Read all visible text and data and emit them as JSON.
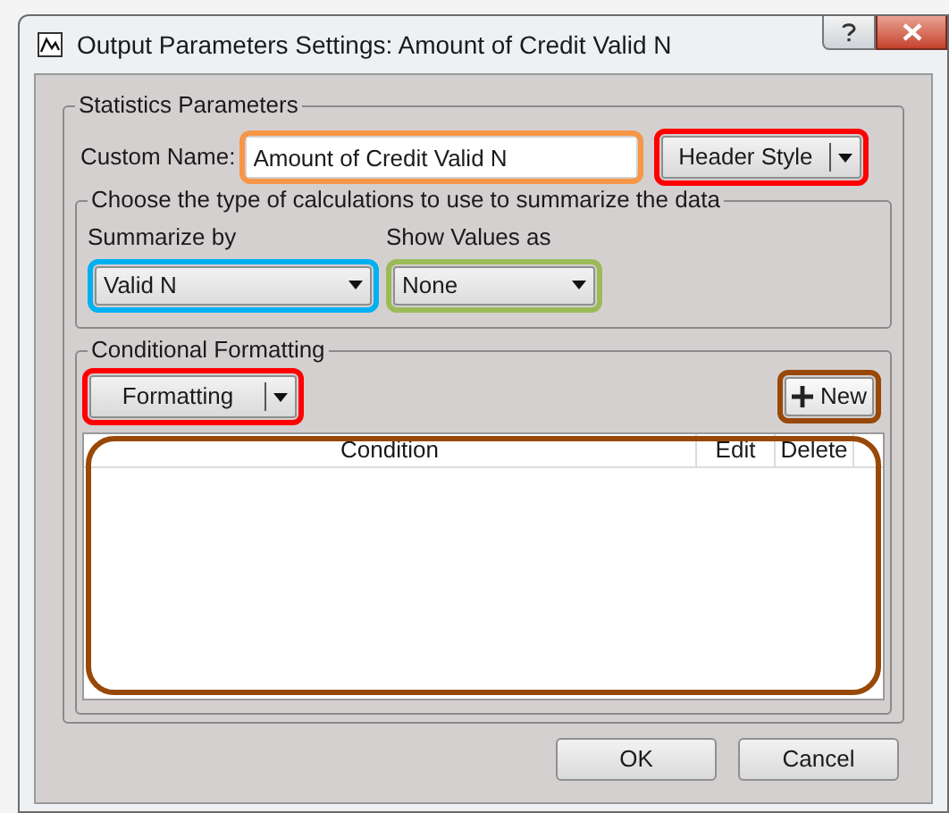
{
  "window": {
    "title": "Output Parameters Settings: Amount of Credit Valid N"
  },
  "statistics_group": {
    "title": "Statistics Parameters",
    "custom_name": {
      "label": "Custom Name:",
      "value": "Amount of Credit Valid N",
      "color": "#f79646"
    },
    "header_style_button": {
      "label": "Header Style",
      "color": "#ff0000"
    },
    "calculation_group": {
      "title": "Choose the type of calculations to use to summarize the data",
      "summarize_by": {
        "label": "Summarize by",
        "value": "Valid N",
        "color": "#00b0f0"
      },
      "show_values_as": {
        "label": "Show Values as",
        "value": "None",
        "color": "#9bbb59"
      }
    },
    "conditional_group": {
      "title": "Conditional Formatting",
      "formatting_button": {
        "label": "Formatting",
        "color": "#ff0000"
      },
      "new_button": {
        "label": "New",
        "color": "#984807"
      },
      "grid": {
        "columns": [
          "Condition",
          "Edit",
          "Delete"
        ],
        "color": "#984807"
      }
    }
  },
  "buttons": [
    "OK",
    "Cancel"
  ]
}
